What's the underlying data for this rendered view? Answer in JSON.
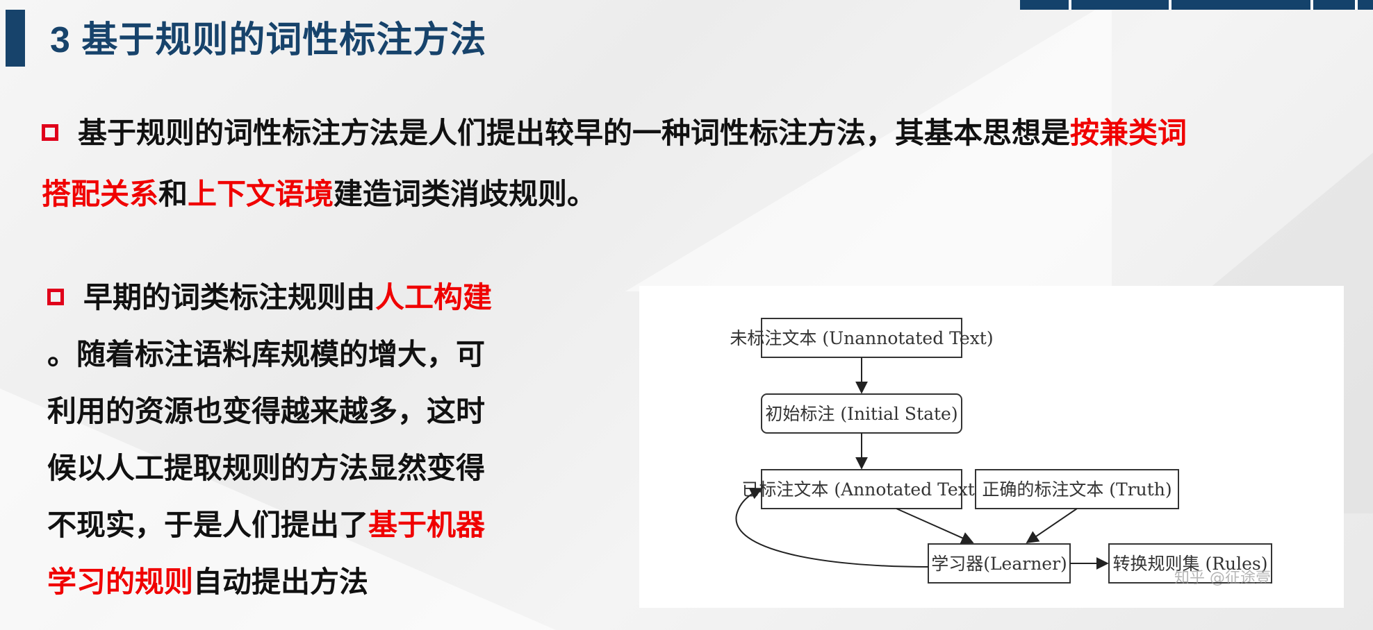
{
  "slide": {
    "title": "3 基于规则的词性标注方法"
  },
  "paragraph1": {
    "line1_text": "基于规则的词性标注方法是人们提出较早的一种词性标注方法，其基本思想是",
    "line1_highlight": "按兼类词",
    "line2_highlight1": "搭配关系",
    "line2_text1": "和",
    "line2_highlight2": "上下文语境",
    "line2_text2": "建造词类消歧规则。"
  },
  "paragraph2": {
    "line1_text": "早期的词类标注规则由",
    "line1_highlight": "人工构建",
    "line2": "。随着标注语料库规模的增大，可",
    "line3": "利用的资源也变得越来越多，这时",
    "line4": "候以人工提取规则的方法显然变得",
    "line5_text": "不现实，于是人们提出了",
    "line5_highlight": "基于机器",
    "line6_highlight": "学习的规则",
    "line6_text": "自动提出方法"
  },
  "diagram": {
    "nodes": {
      "unannotated": "未标注文本 (Unannotated Text)",
      "initial": "初始标注 (Initial State)",
      "annotated": "已标注文本 (Annotated Text)",
      "truth": "正确的标注文本 (Truth)",
      "learner": "学习器(Learner)",
      "rules": "转换规则集 (Rules)"
    },
    "watermark": "知乎 @征途壹"
  },
  "colors": {
    "title_blue": "#17436b",
    "highlight_red": "#f00000",
    "bullet_red": "#e0001a",
    "text": "#111111"
  }
}
